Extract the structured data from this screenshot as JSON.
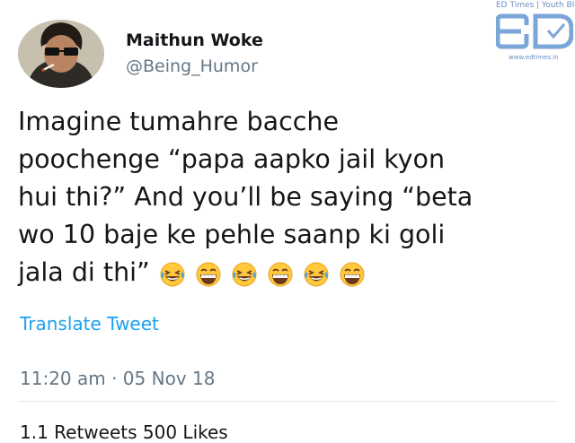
{
  "user": {
    "name": "Maithun Woke",
    "handle": "@Being_Humor"
  },
  "watermark": {
    "tagline": "ED Times | Youth Blog",
    "url": "www.edtimes.in"
  },
  "tweet": {
    "lines": [
      "Imagine tumahre bacche",
      "poochenge “papa aapko jail kyon",
      "hui thi?” And you’ll be saying “beta",
      "wo 10 baje ke pehle saanp ki goli",
      "jala di thi”"
    ],
    "emojis": [
      "crying-laughing",
      "grinning-squint",
      "crying-laughing",
      "grinning-squint",
      "crying-laughing",
      "grinning-squint"
    ]
  },
  "translate_label": "Translate Tweet",
  "meta": "11:20 am · 05 Nov 18",
  "stats_partial": "1.1 Retweets   500 Likes"
}
